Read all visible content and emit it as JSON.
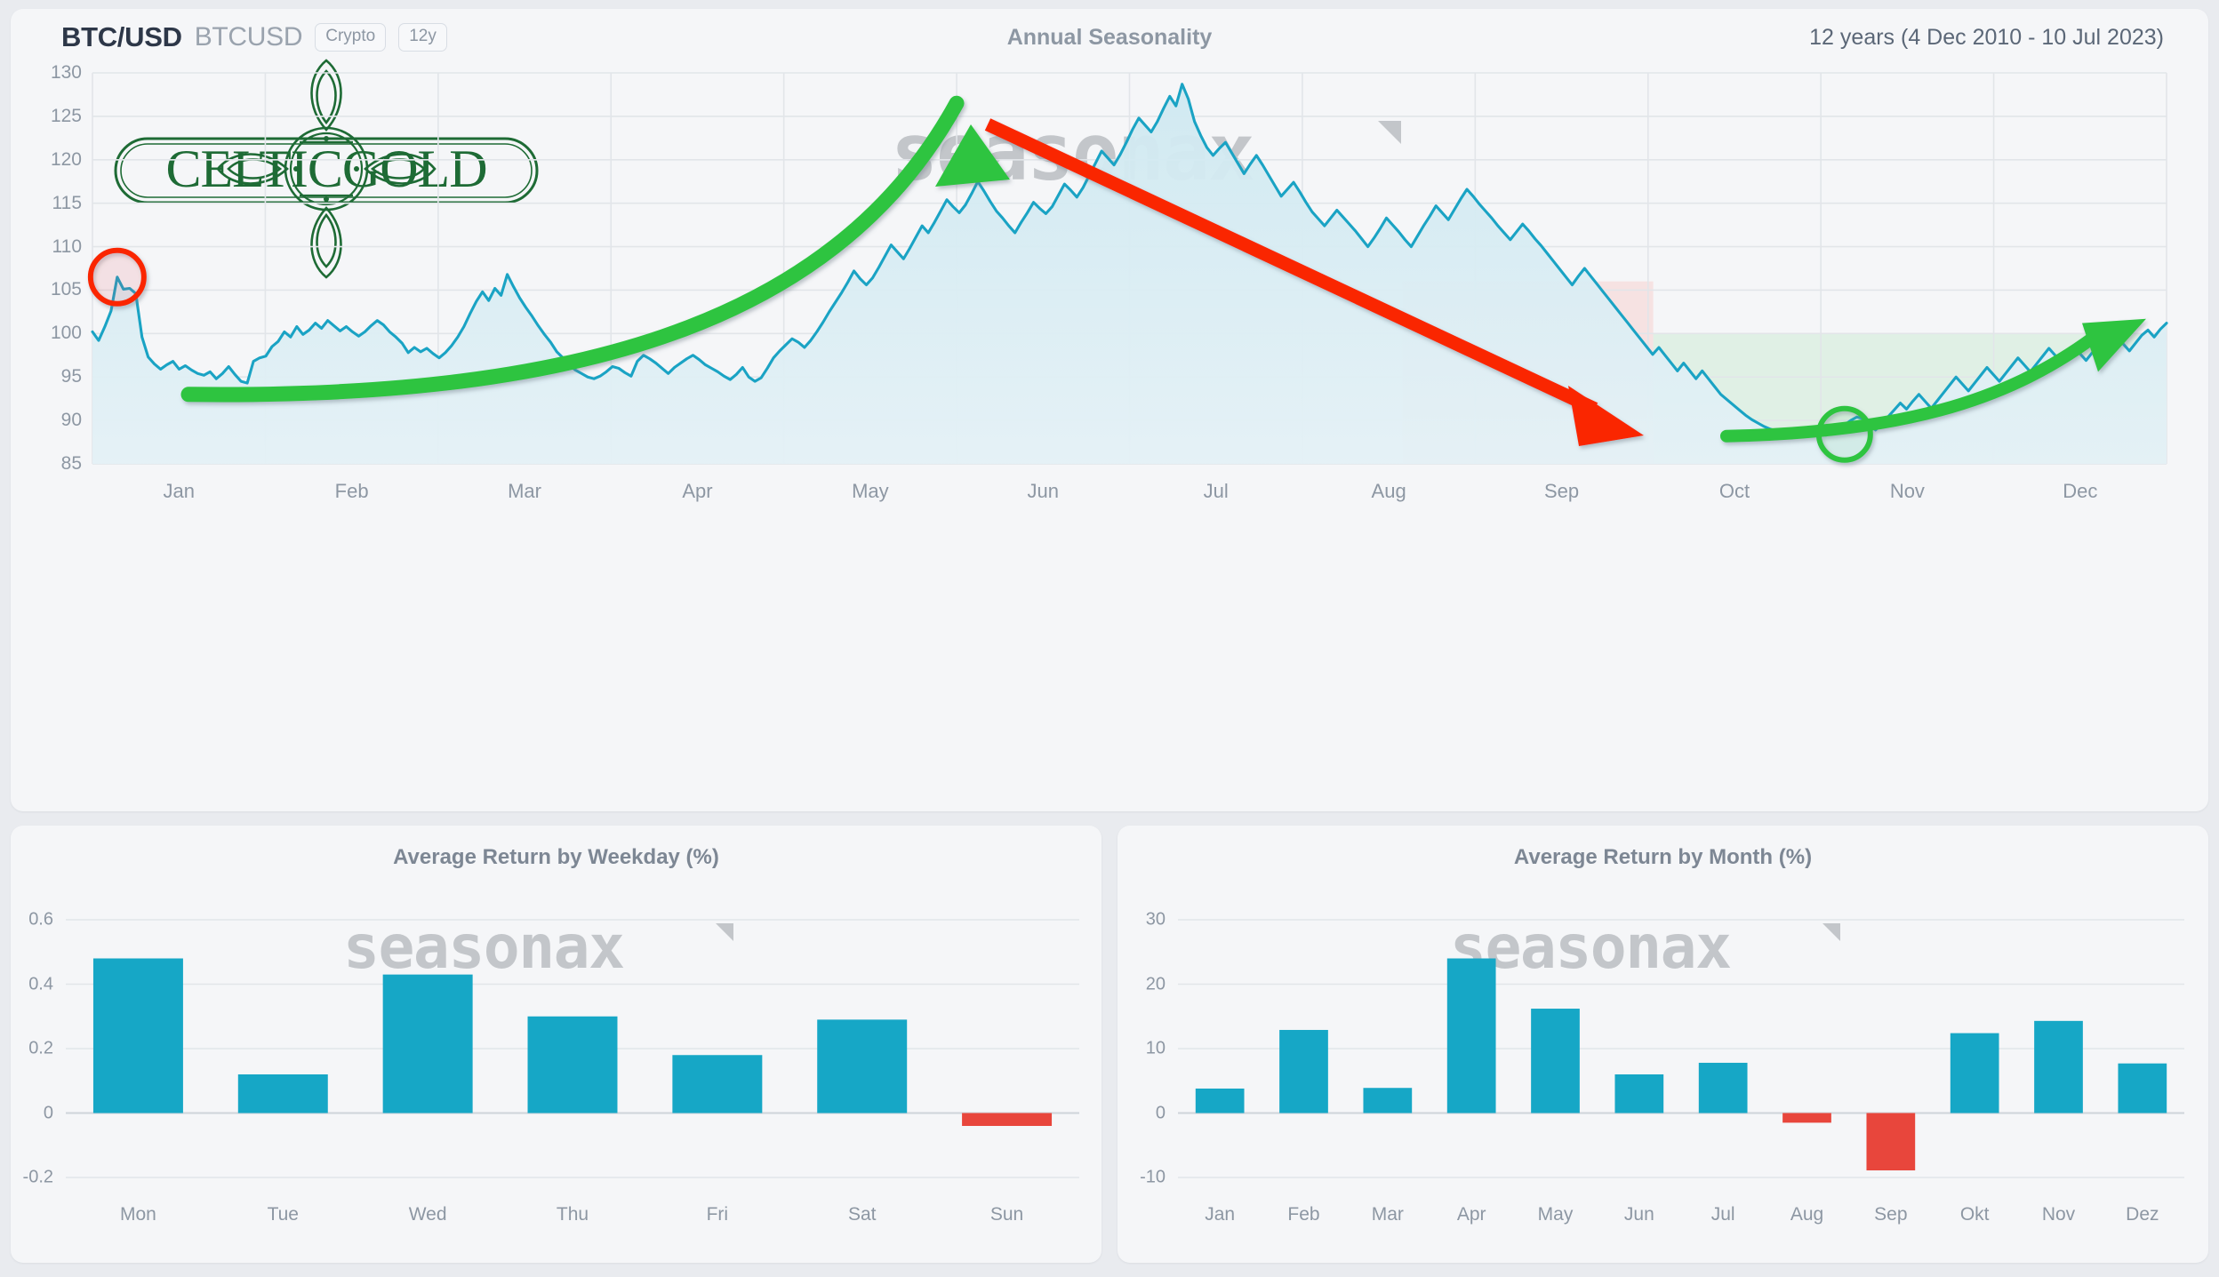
{
  "header": {
    "symbol": "BTC/USD",
    "ticker": "BTCUSD",
    "badge_class": "Crypto",
    "badge_period": "12y",
    "title": "Annual Seasonality",
    "range": "12 years (4 Dec 2010 - 10 Jul 2023)"
  },
  "logo": {
    "text": "CELTICGOLD",
    "color": "#1e6b35"
  },
  "watermark": {
    "text": "seasonax"
  },
  "colors": {
    "line": "#1aa3c4",
    "area_top": "#cfe9f1",
    "area_bottom": "#e4f1f6",
    "positive_bar": "#16a7c6",
    "negative_bar": "#e8463c",
    "arrow_up": "#2dc441",
    "arrow_down": "#fa2600",
    "circle_sell": "#fa2600",
    "circle_buy": "#2dc441",
    "zone_bearish": "#f6dede",
    "zone_bullish": "#dcefe2",
    "grid": "#e2e5e9",
    "panel": "#f5f6f8",
    "page": "#e9ebef"
  },
  "chart_data": [
    {
      "id": "annual-seasonality",
      "type": "line",
      "title": "Annual Seasonality",
      "subtitle": "12 years (4 Dec 2010 - 10 Jul 2023)",
      "xlabel": "",
      "ylabel": "",
      "ylim": [
        85,
        130
      ],
      "yticks": [
        85,
        90,
        95,
        100,
        105,
        110,
        115,
        120,
        125,
        130
      ],
      "grid": true,
      "legend": "none",
      "xticks": [
        "Jan",
        "Feb",
        "Mar",
        "Apr",
        "May",
        "Jun",
        "Jul",
        "Aug",
        "Sep",
        "Oct",
        "Nov",
        "Dec"
      ],
      "x_units": "day-of-year (1-365)",
      "values": [
        100.2,
        99.2,
        100.8,
        102.6,
        106.5,
        105.1,
        105.2,
        104.6,
        99.6,
        97.3,
        96.5,
        95.9,
        96.4,
        96.8,
        95.9,
        96.3,
        95.8,
        95.4,
        95.2,
        95.6,
        94.8,
        95.4,
        96.2,
        95.3,
        94.5,
        94.3,
        96.8,
        97.2,
        97.4,
        98.5,
        99.1,
        100.2,
        99.6,
        100.8,
        99.9,
        100.4,
        101.2,
        100.6,
        101.5,
        100.9,
        100.3,
        100.8,
        100.2,
        99.7,
        100.2,
        100.9,
        101.5,
        101.0,
        100.2,
        99.6,
        98.9,
        97.8,
        98.4,
        97.9,
        98.3,
        97.7,
        97.2,
        97.8,
        98.6,
        99.6,
        100.8,
        102.3,
        103.7,
        104.8,
        103.8,
        105.2,
        104.4,
        106.8,
        105.4,
        104.1,
        103.0,
        102.0,
        100.9,
        99.9,
        99.0,
        97.9,
        97.2,
        96.4,
        95.8,
        95.4,
        95.0,
        94.8,
        95.1,
        95.6,
        96.2,
        96.0,
        95.5,
        95.1,
        96.8,
        97.5,
        97.1,
        96.6,
        96.0,
        95.4,
        96.1,
        96.6,
        97.1,
        97.5,
        97.0,
        96.4,
        96.0,
        95.6,
        95.1,
        94.7,
        95.3,
        96.1,
        95.0,
        94.5,
        94.9,
        96.0,
        97.2,
        98.0,
        98.7,
        99.4,
        99.0,
        98.4,
        99.2,
        100.2,
        101.3,
        102.5,
        103.6,
        104.7,
        105.9,
        107.2,
        106.3,
        105.6,
        106.4,
        107.6,
        108.9,
        110.2,
        109.4,
        108.6,
        109.8,
        111.1,
        112.4,
        111.6,
        112.8,
        114.1,
        115.4,
        114.6,
        113.9,
        114.8,
        116.1,
        117.5,
        116.4,
        115.2,
        114.1,
        113.3,
        112.4,
        111.6,
        112.8,
        113.9,
        115.1,
        114.4,
        113.8,
        114.6,
        115.9,
        117.2,
        116.5,
        115.7,
        116.8,
        118.2,
        119.6,
        121.0,
        120.2,
        119.4,
        120.6,
        122.0,
        123.5,
        124.8,
        124.0,
        123.2,
        124.4,
        125.9,
        127.3,
        126.2,
        128.7,
        127.0,
        124.4,
        122.8,
        121.4,
        120.5,
        121.3,
        122.0,
        120.8,
        119.6,
        118.4,
        119.5,
        120.5,
        119.4,
        118.2,
        117.0,
        115.8,
        116.6,
        117.4,
        116.3,
        115.1,
        114.0,
        113.2,
        112.4,
        113.3,
        114.2,
        113.4,
        112.6,
        111.8,
        110.9,
        110.0,
        111.0,
        112.1,
        113.3,
        112.5,
        111.7,
        110.8,
        110.0,
        111.2,
        112.4,
        113.5,
        114.7,
        113.9,
        113.1,
        114.3,
        115.5,
        116.6,
        115.8,
        114.9,
        114.1,
        113.3,
        112.4,
        111.6,
        110.8,
        111.7,
        112.6,
        111.8,
        110.9,
        110.1,
        109.2,
        108.3,
        107.4,
        106.5,
        105.6,
        106.6,
        107.5,
        106.6,
        105.7,
        104.8,
        103.9,
        103.0,
        102.1,
        101.2,
        100.3,
        99.4,
        98.5,
        97.6,
        98.4,
        97.5,
        96.6,
        95.7,
        96.6,
        95.7,
        94.8,
        95.7,
        94.8,
        93.9,
        93.0,
        92.4,
        91.8,
        91.2,
        90.6,
        90.1,
        89.7,
        89.3,
        89.0,
        88.8,
        88.6,
        88.5,
        88.9,
        88.6,
        89.0,
        88.7,
        88.4,
        88.3,
        88.6,
        89.0,
        89.5,
        90.0,
        90.4,
        90.2,
        89.6,
        88.9,
        89.6,
        90.4,
        91.2,
        92.0,
        91.3,
        92.2,
        93.0,
        92.2,
        91.4,
        92.3,
        93.2,
        94.1,
        95.0,
        94.2,
        93.4,
        94.3,
        95.2,
        96.1,
        95.3,
        94.5,
        95.4,
        96.3,
        97.2,
        96.4,
        95.6,
        96.5,
        97.4,
        98.3,
        97.5,
        96.7,
        97.6,
        98.5,
        97.7,
        96.9,
        97.8,
        98.7,
        97.9,
        98.8,
        99.6,
        98.8,
        98.0,
        98.9,
        99.8,
        100.4,
        99.6,
        100.5,
        101.2
      ],
      "annotations": [
        {
          "type": "circle",
          "label": "january-peak-marker",
          "x_month": "Jan",
          "y": 106.5,
          "color": "#fa2600"
        },
        {
          "type": "circle",
          "label": "october-low-marker",
          "x_month": "Oct",
          "y": 88.5,
          "color": "#2dc441"
        },
        {
          "type": "arrow",
          "label": "bullish-rally-arrow",
          "from_month": "Jan",
          "to_month": "Jun",
          "from_y": 93,
          "to_y": 126,
          "color": "#2dc441"
        },
        {
          "type": "arrow",
          "label": "bearish-decline-arrow",
          "from_month": "Jun",
          "to_month": "Sep",
          "from_y": 125,
          "to_y": 89,
          "color": "#fa2600"
        },
        {
          "type": "arrow",
          "label": "year-end-rally-arrow",
          "from_month": "Oct",
          "to_month": "Dec",
          "from_y": 88.5,
          "to_y": 100,
          "color": "#2dc441"
        },
        {
          "type": "zone",
          "label": "bearish-zone",
          "from_month": "Aug",
          "to_month": "Oct",
          "y_from": 85,
          "y_to": 106,
          "color": "#f6dede"
        },
        {
          "type": "zone",
          "label": "bullish-zone",
          "from_month": "Oct",
          "to_month": "Dec",
          "y_from": 85,
          "y_to": 100,
          "color": "#dcefe2"
        }
      ]
    },
    {
      "id": "avg-return-weekday",
      "type": "bar",
      "title": "Average Return by Weekday (%)",
      "xlabel": "",
      "ylabel": "",
      "ylim": [
        -0.2,
        0.6
      ],
      "yticks": [
        -0.2,
        0,
        0.2,
        0.4,
        0.6
      ],
      "ytick_labels": [
        "-0.2",
        "0",
        "0.2",
        "0.4",
        "0.6"
      ],
      "grid": true,
      "categories": [
        "Mon",
        "Tue",
        "Wed",
        "Thu",
        "Fri",
        "Sat",
        "Sun"
      ],
      "values": [
        0.48,
        0.12,
        0.43,
        0.3,
        0.18,
        0.29,
        -0.04
      ]
    },
    {
      "id": "avg-return-month",
      "type": "bar",
      "title": "Average Return by Month (%)",
      "xlabel": "",
      "ylabel": "",
      "ylim": [
        -10,
        30
      ],
      "yticks": [
        -10,
        0,
        10,
        20,
        30
      ],
      "ytick_labels": [
        "-10",
        "0",
        "10",
        "20",
        "30"
      ],
      "grid": true,
      "categories": [
        "Jan",
        "Feb",
        "Mar",
        "Apr",
        "May",
        "Jun",
        "Jul",
        "Aug",
        "Sep",
        "Okt",
        "Nov",
        "Dez"
      ],
      "values": [
        3.8,
        12.9,
        3.9,
        24.0,
        16.2,
        6.0,
        7.8,
        -1.5,
        -8.9,
        12.4,
        14.3,
        7.7
      ]
    }
  ]
}
